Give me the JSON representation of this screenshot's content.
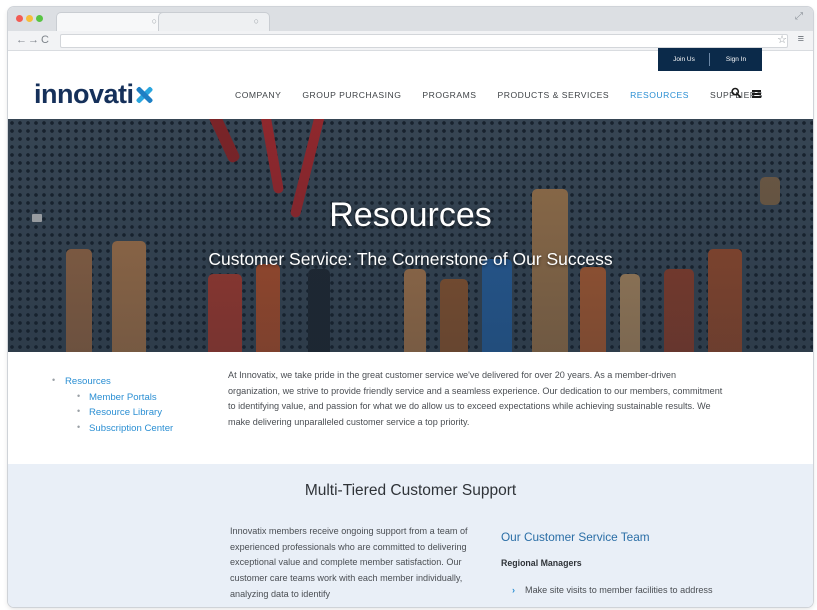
{
  "browser": {
    "tabs": [
      {
        "label": ""
      },
      {
        "label": ""
      }
    ],
    "url": ""
  },
  "header": {
    "join_label": "Join Us",
    "signin_label": "Sign In",
    "logo_text": "innovati",
    "nav": [
      {
        "label": "COMPANY",
        "active": false
      },
      {
        "label": "GROUP PURCHASING",
        "active": false
      },
      {
        "label": "PROGRAMS",
        "active": false
      },
      {
        "label": "PRODUCTS & SERVICES",
        "active": false
      },
      {
        "label": "RESOURCES",
        "active": true
      },
      {
        "label": "SUPPLIERS",
        "active": false
      }
    ],
    "icons": {
      "search": "search-icon",
      "menu": "hamburger-icon"
    },
    "accent_color": "#2b8fd3",
    "brand_color": "#15305a"
  },
  "hero": {
    "title": "Resources",
    "subtitle": "Customer Service: The Cornerstone of Our Success"
  },
  "sidenav": {
    "top": "Resources",
    "items": [
      "Member Portals",
      "Resource Library",
      "Subscription Center"
    ]
  },
  "intro": {
    "text": "At Innovatix, we take pride in the great customer service we've delivered for over 20 years. As a member-driven organization, we strive to provide friendly service and a seamless experience. Our dedication to our members, commitment to identifying value, and passion for what we do allow us to exceed expectations while achieving sustainable results. We make delivering unparalleled customer service a top priority."
  },
  "support": {
    "title": "Multi-Tiered Customer Support",
    "text": "Innovatix members receive ongoing support from a team of experienced professionals who are committed to delivering exceptional value and complete member satisfaction. Our customer care teams work with each member individually, analyzing data to identify",
    "team_title": "Our Customer Service Team",
    "team_subtitle": "Regional Managers",
    "team_bullets": [
      "Make site visits to member facilities to address"
    ]
  }
}
